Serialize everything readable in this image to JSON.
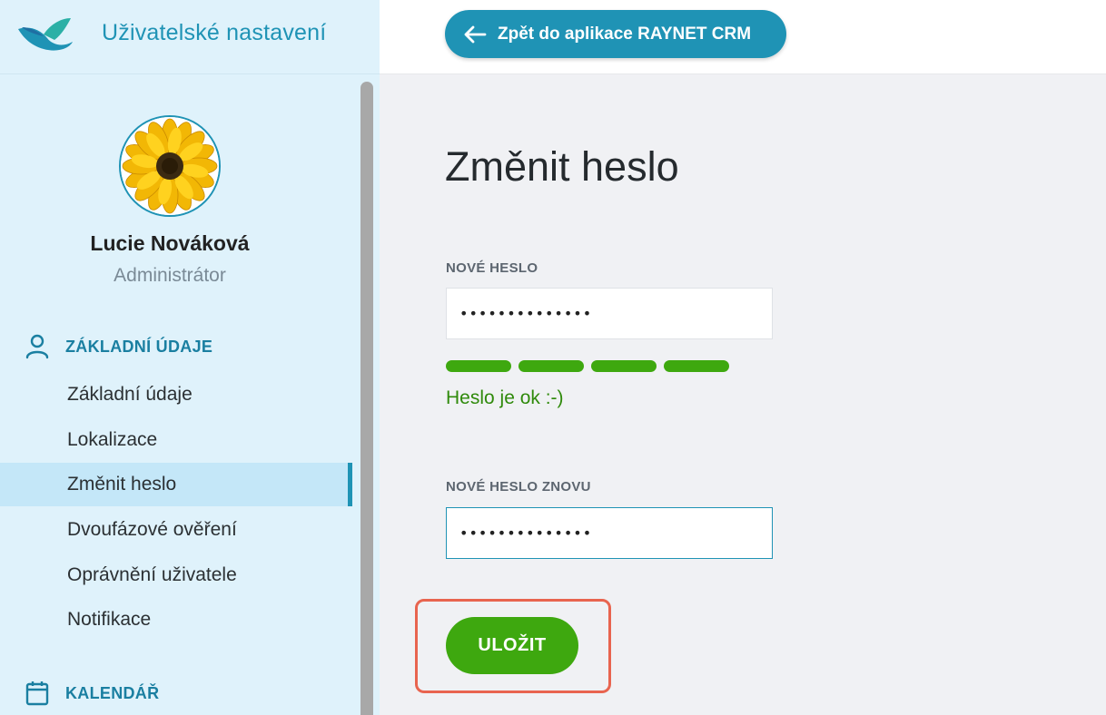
{
  "app": {
    "title": "Uživatelské nastavení",
    "back_button_label": "Zpět do aplikace RAYNET CRM"
  },
  "user": {
    "name": "Lucie Nováková",
    "role": "Administrátor"
  },
  "sidebar": {
    "sections": [
      {
        "label": "ZÁKLADNÍ ÚDAJE",
        "icon": "person-icon",
        "items": [
          {
            "label": "Základní údaje"
          },
          {
            "label": "Lokalizace"
          },
          {
            "label": "Změnit heslo",
            "active": true
          },
          {
            "label": "Dvoufázové ověření"
          },
          {
            "label": "Oprávnění uživatele"
          },
          {
            "label": "Notifikace"
          }
        ]
      },
      {
        "label": "KALENDÁŘ",
        "icon": "calendar-icon",
        "items": []
      }
    ]
  },
  "form": {
    "title": "Změnit heslo",
    "new_password_label": "NOVÉ HESLO",
    "new_password_value": "••••••••••••••",
    "strength_text": "Heslo je ok :-)",
    "strength_level": "4/4",
    "repeat_password_label": "NOVÉ HESLO ZNOVU",
    "repeat_password_value": "••••••••••••••",
    "save_label": "ULOŽIT"
  },
  "colors": {
    "accent": "#1f93b5",
    "sidebar_bg": "#dff2fb",
    "success": "#3ea80f",
    "highlight": "#e8644f"
  }
}
